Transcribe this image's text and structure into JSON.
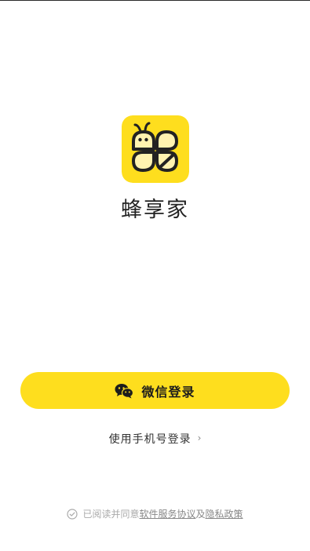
{
  "app": {
    "name": "蜂享家",
    "logo_icon": "bee-logo-icon",
    "brand_color": "#FEDE1E"
  },
  "login": {
    "wechat_label": "微信登录",
    "wechat_icon": "wechat-icon",
    "phone_label": "使用手机号登录",
    "phone_chevron": "›"
  },
  "agreement": {
    "prefix": "已阅读并同意",
    "terms_link": "软件服务协议",
    "joiner": "及",
    "privacy_link": "隐私政策",
    "checkbox_icon": "check-circle-icon"
  }
}
